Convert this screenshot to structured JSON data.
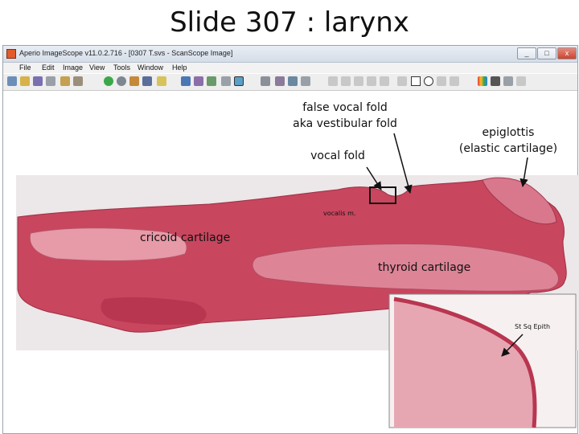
{
  "slide": {
    "title": "Slide 307 : larynx"
  },
  "window": {
    "title": "Aperio ImageScope v11.0.2.716 - [0307 T.svs - ScanScope Image]",
    "controls": {
      "minimize": "_",
      "maximize": "□",
      "close": "x"
    }
  },
  "menu": [
    "File",
    "Edit",
    "Image",
    "View",
    "Tools",
    "Window",
    "Help"
  ],
  "annotations": {
    "false_vocal_fold": {
      "line1": "false vocal fold",
      "line2": "aka vestibular fold"
    },
    "vocal_fold": "vocal fold",
    "epiglottis": {
      "line1": "epiglottis",
      "line2": "(elastic cartilage)"
    },
    "vocalis": "vocalis m.",
    "cricoid": "cricoid cartilage",
    "thyroid": "thyroid cartilage",
    "inset_label": "St Sq Epith"
  },
  "colors": {
    "tissue_dark": "#c0405a",
    "tissue_light": "#e79aa8",
    "background_slide": "#ece7e8",
    "inset_bg": "#f6f1f0"
  }
}
